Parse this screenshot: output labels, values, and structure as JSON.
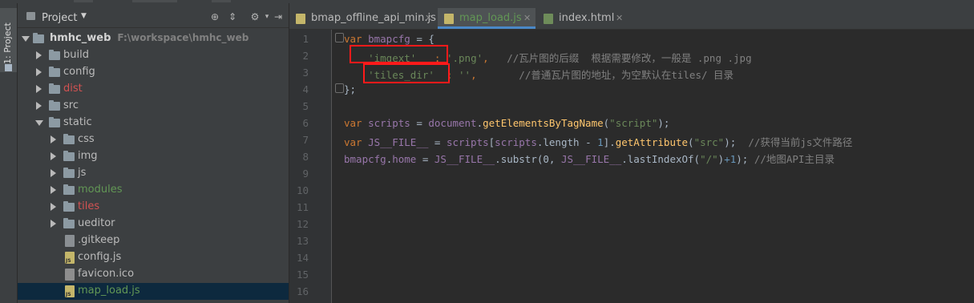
{
  "tool_window": {
    "label": "1: Project"
  },
  "project_panel": {
    "title": "Project",
    "tree": [
      {
        "label": "hmhc_web",
        "path": "F:\\workspace\\hmhc_web",
        "type": "folder",
        "depth": 0,
        "expanded": true,
        "color": "#d4d4d4",
        "bold": true
      },
      {
        "label": "build",
        "type": "folder",
        "depth": 1,
        "expanded": false,
        "color": "#bbbbbb"
      },
      {
        "label": "config",
        "type": "folder",
        "depth": 1,
        "expanded": false,
        "color": "#bbbbbb"
      },
      {
        "label": "dist",
        "type": "folder",
        "depth": 1,
        "expanded": false,
        "color": "#d25252"
      },
      {
        "label": "src",
        "type": "folder",
        "depth": 1,
        "expanded": false,
        "color": "#bbbbbb"
      },
      {
        "label": "static",
        "type": "folder",
        "depth": 1,
        "expanded": true,
        "color": "#bbbbbb"
      },
      {
        "label": "css",
        "type": "folder",
        "depth": 2,
        "expanded": false,
        "color": "#bbbbbb"
      },
      {
        "label": "img",
        "type": "folder",
        "depth": 2,
        "expanded": false,
        "color": "#bbbbbb"
      },
      {
        "label": "js",
        "type": "folder",
        "depth": 2,
        "expanded": false,
        "color": "#bbbbbb"
      },
      {
        "label": "modules",
        "type": "folder",
        "depth": 2,
        "expanded": false,
        "color": "#629755"
      },
      {
        "label": "tiles",
        "type": "folder",
        "depth": 2,
        "expanded": false,
        "color": "#d25252"
      },
      {
        "label": "ueditor",
        "type": "folder",
        "depth": 2,
        "expanded": false,
        "color": "#bbbbbb"
      },
      {
        "label": ".gitkeep",
        "type": "git",
        "depth": 2,
        "color": "#bbbbbb"
      },
      {
        "label": "config.js",
        "type": "js",
        "depth": 2,
        "color": "#bbbbbb"
      },
      {
        "label": "favicon.ico",
        "type": "ico",
        "depth": 2,
        "color": "#bbbbbb"
      },
      {
        "label": "map_load.js",
        "type": "js",
        "depth": 2,
        "color": "#629755",
        "selected": true
      }
    ]
  },
  "editor": {
    "tabs": [
      {
        "label": "bmap_offline_api_min.js",
        "icon": "js-file-icon",
        "active": false,
        "color": "#bbbbbb"
      },
      {
        "label": "map_load.js",
        "icon": "js-file-icon",
        "active": true,
        "color": "#629755"
      },
      {
        "label": "index.html",
        "icon": "html-file-icon",
        "active": false,
        "color": "#bbbbbb"
      }
    ],
    "line_numbers": [
      "1",
      "2",
      "3",
      "4",
      "5",
      "6",
      "7",
      "8",
      "9",
      "10",
      "11",
      "12",
      "13",
      "14",
      "15",
      "16"
    ],
    "code": {
      "l1": {
        "kw": "var",
        "name": "bmapcfg",
        "rest": " = {"
      },
      "l2": {
        "key": "'imgext'",
        "sep": "   : ",
        "val": "'.png'",
        "tail": ",   ",
        "comment": "//瓦片图的后缀  根据需要修改，一般是 .png .jpg"
      },
      "l3": {
        "key": "'tiles_dir'",
        "sep": "  : ",
        "val": "''",
        "tail": ",       ",
        "comment": "//普通瓦片图的地址，为空默认在tiles/ 目录"
      },
      "l4": {
        "text": "};"
      },
      "l6": {
        "kw": "var",
        "name": "scripts",
        "eq": " = ",
        "obj": "document",
        "dot": ".",
        "fn": "getElementsByTagName",
        "open": "(",
        "arg": "\"script\"",
        "close": ");"
      },
      "l7": {
        "kw": "var",
        "name": "JS__FILE__",
        "eq": " = ",
        "obj": "scripts",
        "b1": "[",
        "obj2": "scripts",
        "prop": ".length - ",
        "num": "1",
        "b2": "].",
        "fn": "getAttribute",
        "open": "(",
        "arg": "\"src\"",
        "close": ");  ",
        "comment": "//获得当前js文件路径"
      },
      "l8": {
        "obj": "bmapcfg",
        "dot": ".",
        "prop": "home",
        "eq": " = ",
        "v1": "JS__FILE__",
        "m1": ".substr(0, ",
        "v2": "JS__FILE__",
        "m2": ".lastIndexOf(",
        "arg": "\"/\"",
        "m3": ")",
        "plus": "+1",
        "close": "); ",
        "comment": "//地图API主目录"
      }
    }
  }
}
